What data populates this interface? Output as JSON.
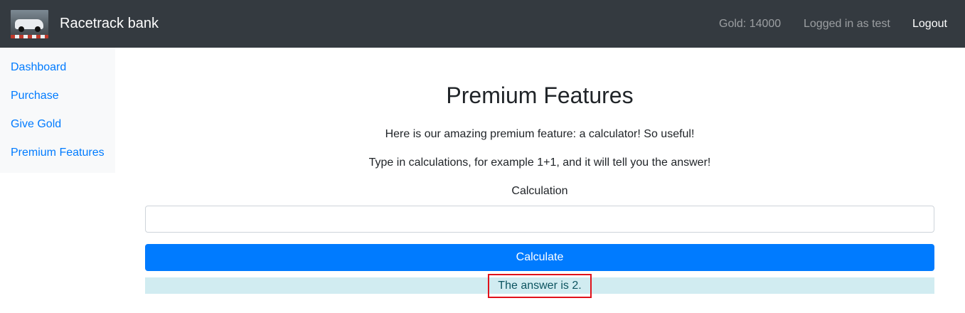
{
  "navbar": {
    "brand": "Racetrack bank",
    "gold": "Gold: 14000",
    "user": "Logged in as test",
    "logout": "Logout"
  },
  "sidebar": {
    "items": [
      {
        "label": "Dashboard"
      },
      {
        "label": "Purchase"
      },
      {
        "label": "Give Gold"
      },
      {
        "label": "Premium Features"
      }
    ]
  },
  "main": {
    "title": "Premium Features",
    "intro": "Here is our amazing premium feature: a calculator! So useful!",
    "instructions": "Type in calculations, for example 1+1, and it will tell you the answer!",
    "calc_label": "Calculation",
    "calc_value": "",
    "calc_button": "Calculate",
    "result": "The answer is 2."
  },
  "colors": {
    "navbar_bg": "#343a40",
    "link": "#007bff",
    "button": "#007bff",
    "result_bg": "#d1ecf1",
    "highlight_border": "#e0121b"
  }
}
